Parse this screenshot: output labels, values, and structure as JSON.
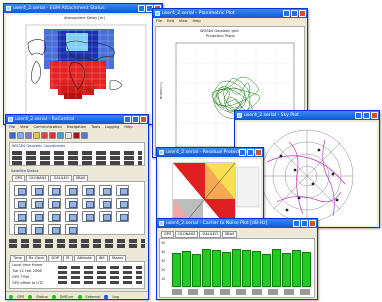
{
  "earth_window": {
    "title": "user4_2.serial - EGM Attachment Status",
    "map_title": "Atmosphere Delay [m]"
  },
  "plane_window": {
    "title": "user4_2.serial - Planimetric Plot",
    "menu": [
      "File",
      "Edit",
      "View",
      "Help"
    ],
    "plot_title": "WGS84 Geodetic grid",
    "plot_subtitle": "Projection Plane"
  },
  "skyplot_window": {
    "title": "user4_2.serial - Sky Plot"
  },
  "control_window": {
    "title": "user4_2.serial - RxControl",
    "menu": [
      "File",
      "View",
      "Communication",
      "Navigation",
      "Tools",
      "Logging",
      "Help"
    ],
    "coords_title": "WGS84 Geodetic Coordinates",
    "satellite_status": "Satellite Status",
    "constellation_tabs": [
      "GPS",
      "GLONASS",
      "GALILEO",
      "SBAS"
    ],
    "bottom_tabs": [
      "Time",
      "Rx Clock",
      "DOP",
      "PL",
      "Attitude",
      "INS",
      "Status"
    ],
    "status_items": [
      "GPS",
      "Status",
      "DiffCorr",
      "External",
      "Log"
    ],
    "time_label": "Local time frame",
    "date_label": "Tue 12 Feb 2008",
    "tow_label": "GPS TOW",
    "offset_label": "GPS offset to UTC"
  },
  "residual_window": {
    "title": "user4_2.serial - Residual Protection Level"
  },
  "cn0_window": {
    "title": "user4_2.serial - Carrier to Noise Plot [dB-Hz]",
    "bar_values": [
      41,
      43,
      40,
      45,
      44,
      42,
      46,
      44,
      43,
      39,
      45,
      41,
      44,
      42
    ],
    "y_ticks": [
      "50",
      "40",
      "30",
      "20",
      "10"
    ]
  }
}
